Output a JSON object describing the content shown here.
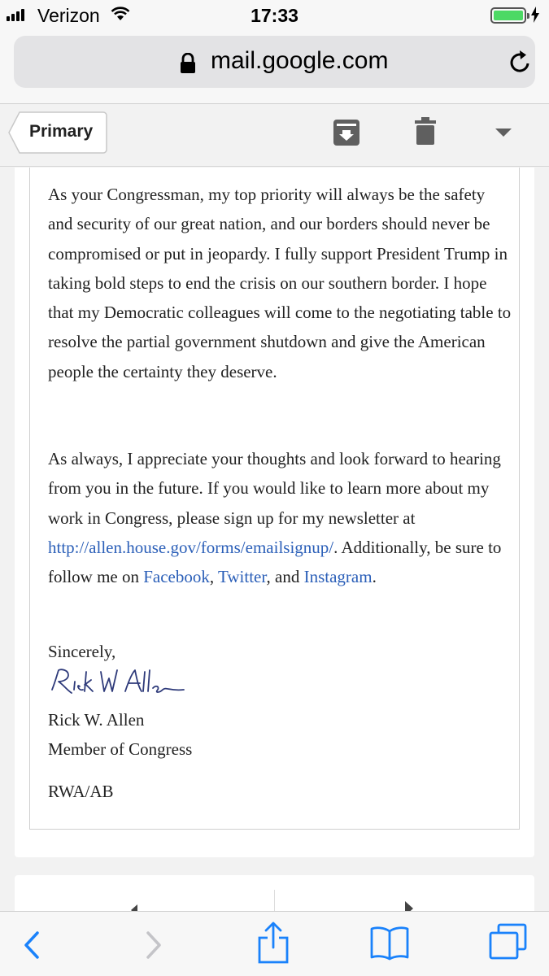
{
  "status_bar": {
    "carrier": "Verizon",
    "time": "17:33",
    "battery_level": 1.0
  },
  "address_bar": {
    "url": "mail.google.com"
  },
  "gmail_toolbar": {
    "back_label": "Primary"
  },
  "email": {
    "paragraph1": "As your Congressman, my top priority will always be the safety and security of our great nation, and our borders should never be compromised or put in jeopardy.  I fully support President Trump in taking bold steps to end the crisis on our southern border.  I hope that my Democratic colleagues will come to the negotiating table to resolve the partial government shutdown and give the American people the certainty they deserve.",
    "paragraph2_intro": "As always, I appreciate your thoughts and look forward to hearing from you in the future. If you would like to learn more about my work in Congress, please sign up for my newsletter at ",
    "newsletter_link": "http://allen.house.gov/forms/emailsignup/",
    "paragraph2_follow": ". Additionally, be sure to follow me on ",
    "facebook_link": "Facebook",
    "comma_sep": ", ",
    "twitter_link": "Twitter",
    "and_sep": ", and ",
    "instagram_link": "Instagram",
    "period": ".",
    "closing": "Sincerely,",
    "signature_text": "Rick W Allen",
    "sender_name": "Rick W. Allen",
    "sender_title": "Member of Congress",
    "initials": "RWA/AB"
  },
  "colors": {
    "link": "#2b5fb8",
    "safari_tint": "#1a82fb",
    "battery": "#4cd964"
  },
  "icons": {
    "signal": "signal-bars-icon",
    "wifi": "wifi-icon",
    "lock": "lock-icon",
    "reload": "reload-icon",
    "archive": "archive-icon",
    "trash": "trash-icon",
    "more": "caret-down-icon",
    "back": "chevron-left-icon",
    "forward": "chevron-right-icon",
    "share": "share-icon",
    "bookmarks": "book-icon",
    "tabs": "tabs-icon"
  }
}
